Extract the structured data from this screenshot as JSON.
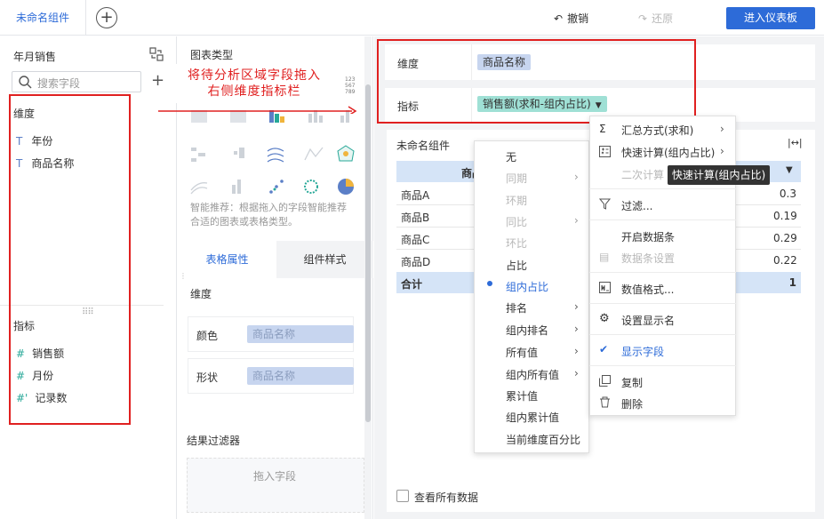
{
  "topbar": {
    "tab_label": "未命名组件",
    "undo_label": "撤销",
    "redo_label": "还原",
    "enter_label": "进入仪表板"
  },
  "left": {
    "dataset": "年月销售",
    "search_placeholder": "搜索字段",
    "dimension_label": "维度",
    "dimensions": [
      {
        "label": "年份",
        "icon": "text-type-icon"
      },
      {
        "label": "商品名称",
        "icon": "text-type-icon"
      }
    ],
    "measure_label": "指标",
    "measures": [
      {
        "label": "销售额",
        "icon": "number-type-icon"
      },
      {
        "label": "月份",
        "icon": "number-type-icon"
      },
      {
        "label": "记录数",
        "icon": "calc-number-icon"
      }
    ]
  },
  "middle": {
    "chart_type_label": "图表类型",
    "smart_tip": "智能推荐：根据拖入的字段智能推荐合适的图表或表格类型。",
    "tab_table": "表格属性",
    "tab_style": "组件样式",
    "dim_label": "维度",
    "color_label": "颜色",
    "color_chip": "商品名称",
    "shape_label": "形状",
    "shape_chip": "商品名称",
    "filter_label": "结果过滤器",
    "filter_placeholder": "拖入字段"
  },
  "annotation": {
    "line1": "将待分析区域字段拖入",
    "line2": "右侧维度指标栏"
  },
  "right": {
    "dim_label": "维度",
    "dim_chip": "商品名称",
    "measure_label": "指标",
    "measure_chip": "销售额(求和-组内占比)",
    "widget_title": "未命名组件",
    "table_header": "商品",
    "rows": [
      {
        "name": "商品A",
        "value": "0.3"
      },
      {
        "name": "商品B",
        "value": "0.19"
      },
      {
        "name": "商品C",
        "value": "0.29"
      },
      {
        "name": "商品D",
        "value": "0.22"
      }
    ],
    "total_label": "合计",
    "total_value": "1",
    "show_all_label": "查看所有数据"
  },
  "menu1": [
    {
      "label": "无",
      "disabled": false
    },
    {
      "label": "同期",
      "disabled": true,
      "arrow": true
    },
    {
      "label": "环期",
      "disabled": true
    },
    {
      "label": "同比",
      "disabled": true,
      "arrow": true
    },
    {
      "label": "环比",
      "disabled": true
    },
    {
      "label": "占比",
      "disabled": false
    },
    {
      "label": "组内占比",
      "disabled": false,
      "selected": true
    },
    {
      "label": "排名",
      "disabled": false,
      "arrow": true
    },
    {
      "label": "组内排名",
      "disabled": false,
      "arrow": true
    },
    {
      "label": "所有值",
      "disabled": false,
      "arrow": true
    },
    {
      "label": "组内所有值",
      "disabled": false,
      "arrow": true
    },
    {
      "label": "累计值",
      "disabled": false
    },
    {
      "label": "组内累计值",
      "disabled": false
    },
    {
      "label": "当前维度百分比",
      "disabled": false
    }
  ],
  "menu2": {
    "summary": "汇总方式(求和)",
    "quickcalc": "快速计算(组内占比)",
    "secondcalc": "二次计算",
    "filter": "过滤...",
    "databar": "开启数据条",
    "databar_set": "数据条设置",
    "numformat": "数值格式...",
    "displayname": "设置显示名",
    "showfield": "显示字段",
    "copy": "复制",
    "delete": "删除"
  },
  "tooltip": "快速计算(组内占比)",
  "colors": {
    "accent": "#2d6bd8",
    "annotation_red": "#e02020",
    "header_blue": "#d5e4f7",
    "measure_chip": "#9fe0d5"
  }
}
